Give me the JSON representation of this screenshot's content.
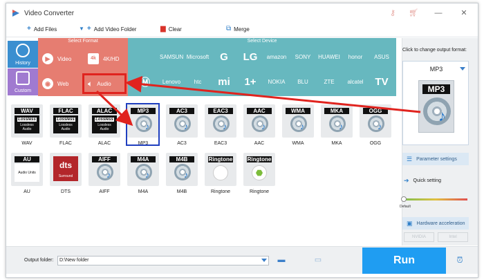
{
  "app": {
    "title": "Video Converter"
  },
  "colors": {
    "format_area": "#e67d71",
    "device_area": "#67b8bf",
    "run_button": "#1f9df2",
    "highlight": "#e0231e",
    "selection": "#1f3fbf"
  },
  "toolbar": {
    "add_files": "Add Files",
    "add_video_folder": "Add Video Folder",
    "clear": "Clear",
    "merge": "Merge"
  },
  "side_tabs": {
    "history": "History",
    "custom": "Custom"
  },
  "format_panel": {
    "header": "Select Format",
    "video": "Video",
    "web": "Web",
    "k4hd": "4K/HD",
    "audio": "Audio"
  },
  "device_panel": {
    "header": "Select Device",
    "row1": [
      "",
      "SAMSUNG",
      "Microsoft",
      "G",
      "LG",
      "amazon",
      "SONY",
      "HUAWEI",
      "honor",
      "ASUS"
    ],
    "row2": [
      "",
      "Lenovo",
      "htc",
      "mi",
      "1+",
      "NOKIA",
      "BLU",
      "ZTE",
      "alcatel",
      "TV"
    ]
  },
  "formats_row1": [
    {
      "badge": "WAV",
      "label": "WAV",
      "kind": "lossless"
    },
    {
      "badge": "FLAC",
      "label": "FLAC",
      "kind": "lossless"
    },
    {
      "badge": "ALAC",
      "label": "ALAC",
      "kind": "lossless"
    },
    {
      "badge": "MP3",
      "label": "MP3",
      "kind": "disc"
    },
    {
      "badge": "AC3",
      "label": "AC3",
      "kind": "disc"
    },
    {
      "badge": "EAC3",
      "label": "EAC3",
      "kind": "disc"
    },
    {
      "badge": "AAC",
      "label": "AAC",
      "kind": "disc"
    },
    {
      "badge": "WMA",
      "label": "WMA",
      "kind": "disc"
    },
    {
      "badge": "MKA",
      "label": "MKA",
      "kind": "disc"
    },
    {
      "badge": "OGG",
      "label": "OGG",
      "kind": "disc"
    }
  ],
  "formats_row2": [
    {
      "badge": "AU",
      "label": "AU",
      "kind": "au"
    },
    {
      "badge": "dts",
      "label": "DTS",
      "kind": "dts"
    },
    {
      "badge": "AIFF",
      "label": "AIFF",
      "kind": "disc"
    },
    {
      "badge": "M4A",
      "label": "M4A",
      "kind": "disc"
    },
    {
      "badge": "M4B",
      "label": "M4B",
      "kind": "disc"
    },
    {
      "badge": "Ringtone",
      "label": "Ringtone",
      "kind": "apple"
    },
    {
      "badge": "Ringtone",
      "label": "Ringtone",
      "kind": "android"
    }
  ],
  "lossless_text": {
    "top": "Lossless",
    "sub1": "Lossless",
    "sub2": "Audio"
  },
  "au_sub": "Audio Units",
  "dts_sub": "Surround",
  "right_panel": {
    "caption": "Click to change output format:",
    "selected_format": "MP3",
    "big_badge": "MP3",
    "parameter_settings": "Parameter settings",
    "quick_setting": "Quick setting",
    "default_label": "Default",
    "hardware_acceleration": "Hardware acceleration",
    "nvidia": "NVIDIA",
    "intel": "Intel"
  },
  "bottom": {
    "output_folder_label": "Output folder:",
    "output_folder_value": "D:\\New folder",
    "run": "Run"
  }
}
